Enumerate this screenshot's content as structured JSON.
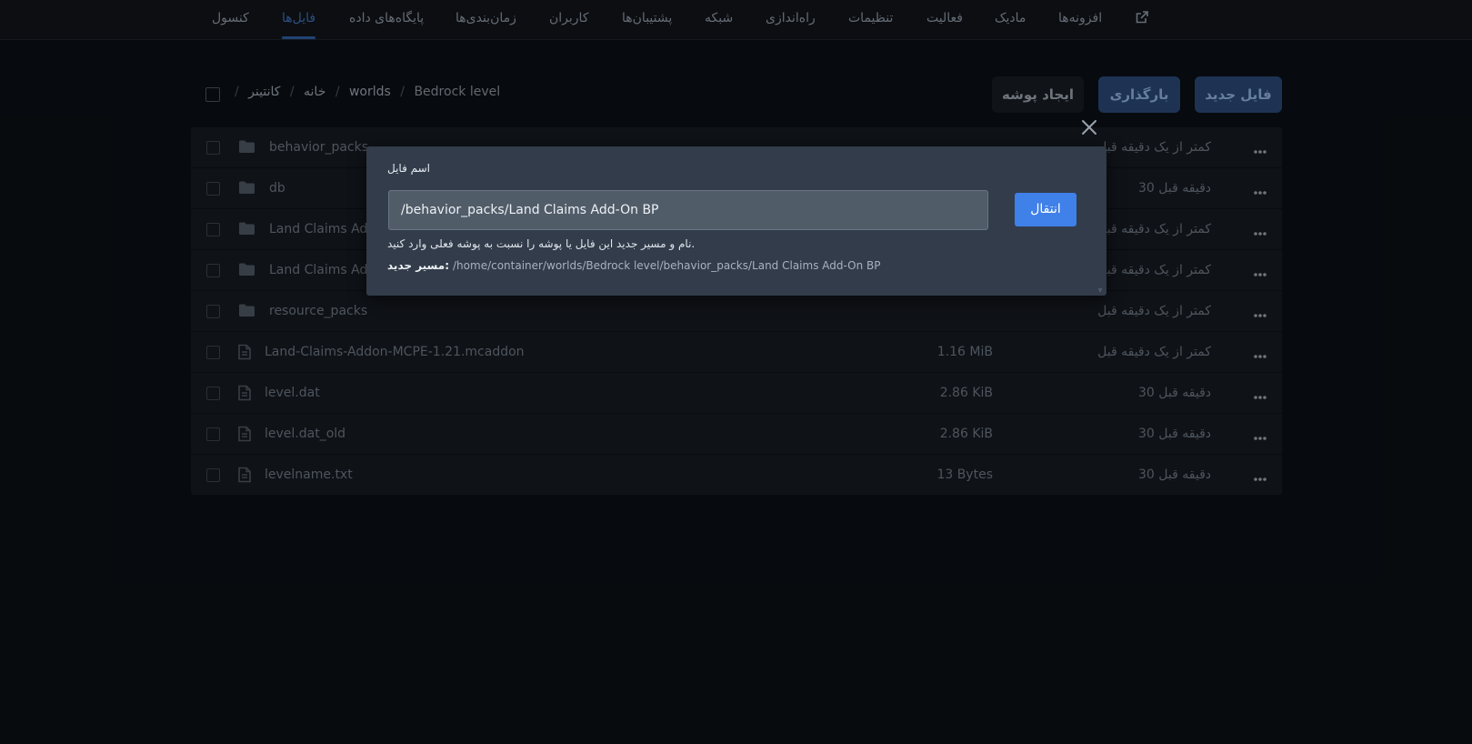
{
  "nav": {
    "items": [
      {
        "label": "کنسول",
        "active": false
      },
      {
        "label": "فایل‌ها",
        "active": true
      },
      {
        "label": "پایگاه‌های داده",
        "active": false
      },
      {
        "label": "زمان‌بندی‌ها",
        "active": false
      },
      {
        "label": "کاربران",
        "active": false
      },
      {
        "label": "پشتیبان‌ها",
        "active": false
      },
      {
        "label": "شبکه",
        "active": false
      },
      {
        "label": "راه‌اندازی",
        "active": false
      },
      {
        "label": "تنظیمات",
        "active": false
      },
      {
        "label": "فعالیت",
        "active": false
      },
      {
        "label": "مادیک",
        "active": false
      },
      {
        "label": "افزونه‌ها",
        "active": false
      }
    ],
    "external_icon": "external-link-icon"
  },
  "breadcrumb": {
    "root": "/",
    "home": "خانه",
    "container": "کانتینر",
    "worlds": "worlds",
    "current": "Bedrock level",
    "sep": "/"
  },
  "toolbar": {
    "create_folder": "ایجاد پوشه",
    "upload": "بارگذاری",
    "new_file": "فایل جدید"
  },
  "files": [
    {
      "type": "folder",
      "name": "behavior_packs",
      "size": "",
      "modified": "کمتر از یک دقیقه قبل"
    },
    {
      "type": "folder",
      "name": "db",
      "size": "",
      "modified": "30 دقیقه قبل"
    },
    {
      "type": "folder",
      "name": "Land Claims Addon",
      "size": "",
      "modified": "کمتر از یک دقیقه قبل"
    },
    {
      "type": "folder",
      "name": "Land Claims Addon",
      "size": "",
      "modified": "کمتر از یک دقیقه قبل"
    },
    {
      "type": "folder",
      "name": "resource_packs",
      "size": "",
      "modified": "کمتر از یک دقیقه قبل"
    },
    {
      "type": "file",
      "name": "Land-Claims-Addon-MCPE-1.21.mcaddon",
      "size": "1.16 MiB",
      "modified": "کمتر از یک دقیقه قبل"
    },
    {
      "type": "file",
      "name": "level.dat",
      "size": "2.86 KiB",
      "modified": "30 دقیقه قبل"
    },
    {
      "type": "file",
      "name": "level.dat_old",
      "size": "2.86 KiB",
      "modified": "30 دقیقه قبل"
    },
    {
      "type": "file",
      "name": "levelname.txt",
      "size": "13 Bytes",
      "modified": "30 دقیقه قبل"
    }
  ],
  "modal": {
    "label": "اسم فایل",
    "input_value": "/behavior_packs/Land Claims Add-On BP",
    "submit": "انتقال",
    "help": "نام و مسیر جدید این فایل یا پوشه را نسبت به پوشه فعلی وارد کنید.",
    "new_path_label": "مسیر جدید:",
    "new_path_value": "/home/container/worlds/Bedrock level/behavior_packs/Land Claims Add-On BP"
  },
  "colors": {
    "accent": "#3f80e9",
    "active_tab": "#2f5ea3",
    "background": "#0b0f14"
  }
}
